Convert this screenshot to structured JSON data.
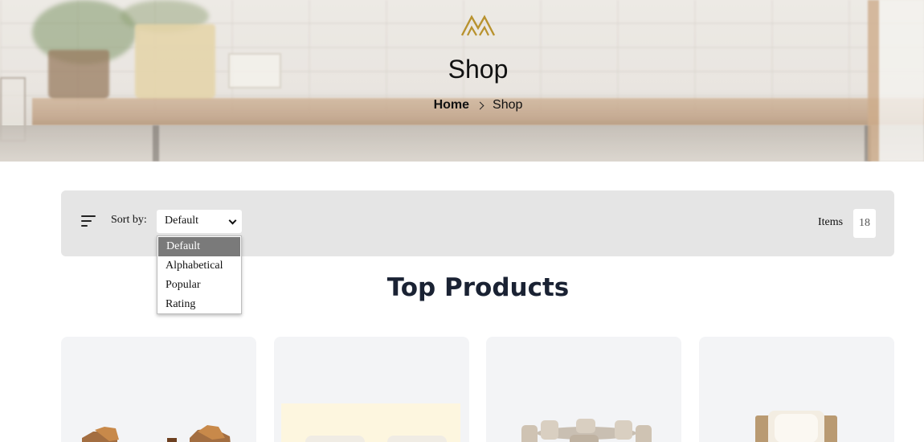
{
  "hero": {
    "title": "Shop",
    "breadcrumb": {
      "home": "Home",
      "current": "Shop"
    },
    "logo_color": "#b8922e"
  },
  "toolbar": {
    "sort_label": "Sort by:",
    "sort_selected": "Default",
    "items_label": "Items",
    "items_count": "18"
  },
  "sort_dropdown": {
    "options": [
      "Default",
      "Alphabetical",
      "Popular",
      "Rating"
    ],
    "selected_index": 0
  },
  "section": {
    "title": "Top Products"
  },
  "products": [
    {
      "image": "wooden-chairs-image"
    },
    {
      "image": "sofa-image"
    },
    {
      "image": "dining-set-image"
    },
    {
      "image": "cushion-chair-image"
    }
  ],
  "colors": {
    "toolbar_bg": "#e5e5e5",
    "card_bg": "#f3f4f6",
    "title_color": "#1a2233",
    "dropdown_selected_bg": "#7a7a7a"
  }
}
